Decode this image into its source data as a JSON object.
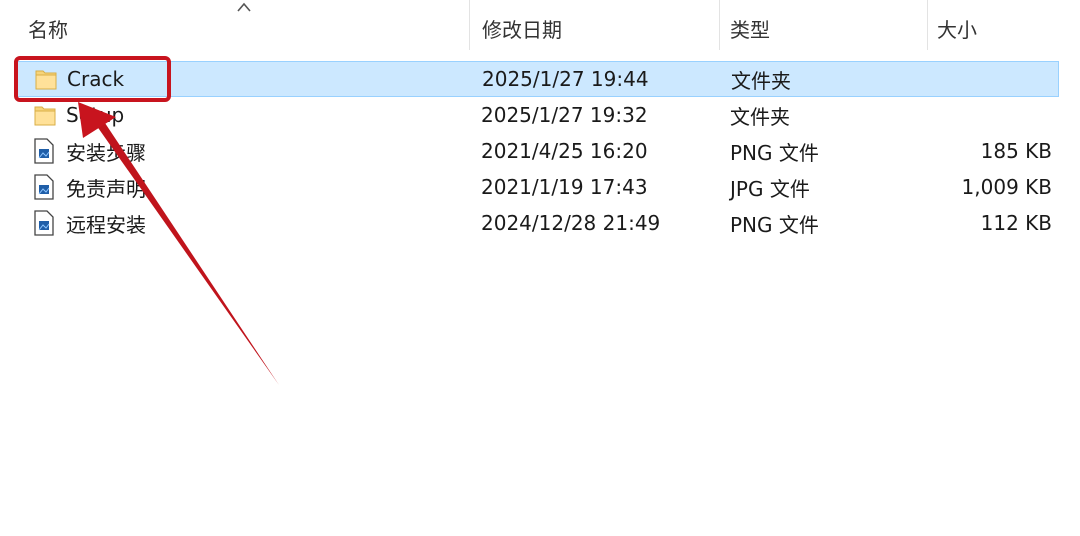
{
  "header": {
    "name": "名称",
    "date": "修改日期",
    "type": "类型",
    "size": "大小"
  },
  "rows": [
    {
      "name": "Crack",
      "date": "2025/1/27 19:44",
      "type": "文件夹",
      "size": "",
      "icon": "folder-icon",
      "selected": true
    },
    {
      "name": "Setup",
      "date": "2025/1/27 19:32",
      "type": "文件夹",
      "size": "",
      "icon": "folder-icon",
      "selected": false
    },
    {
      "name": "安装步骤",
      "date": "2021/4/25 16:20",
      "type": "PNG 文件",
      "size": "185 KB",
      "icon": "image-file-icon",
      "selected": false
    },
    {
      "name": "免责声明",
      "date": "2021/1/19 17:43",
      "type": "JPG 文件",
      "size": "1,009 KB",
      "icon": "image-file-icon",
      "selected": false
    },
    {
      "name": "远程安装",
      "date": "2024/12/28 21:49",
      "type": "PNG 文件",
      "size": "112 KB",
      "icon": "image-file-icon",
      "selected": false
    }
  ],
  "colors": {
    "selection_background": "#cce8ff",
    "selection_border": "#99d1ff",
    "annotation_red": "#c8141e"
  }
}
